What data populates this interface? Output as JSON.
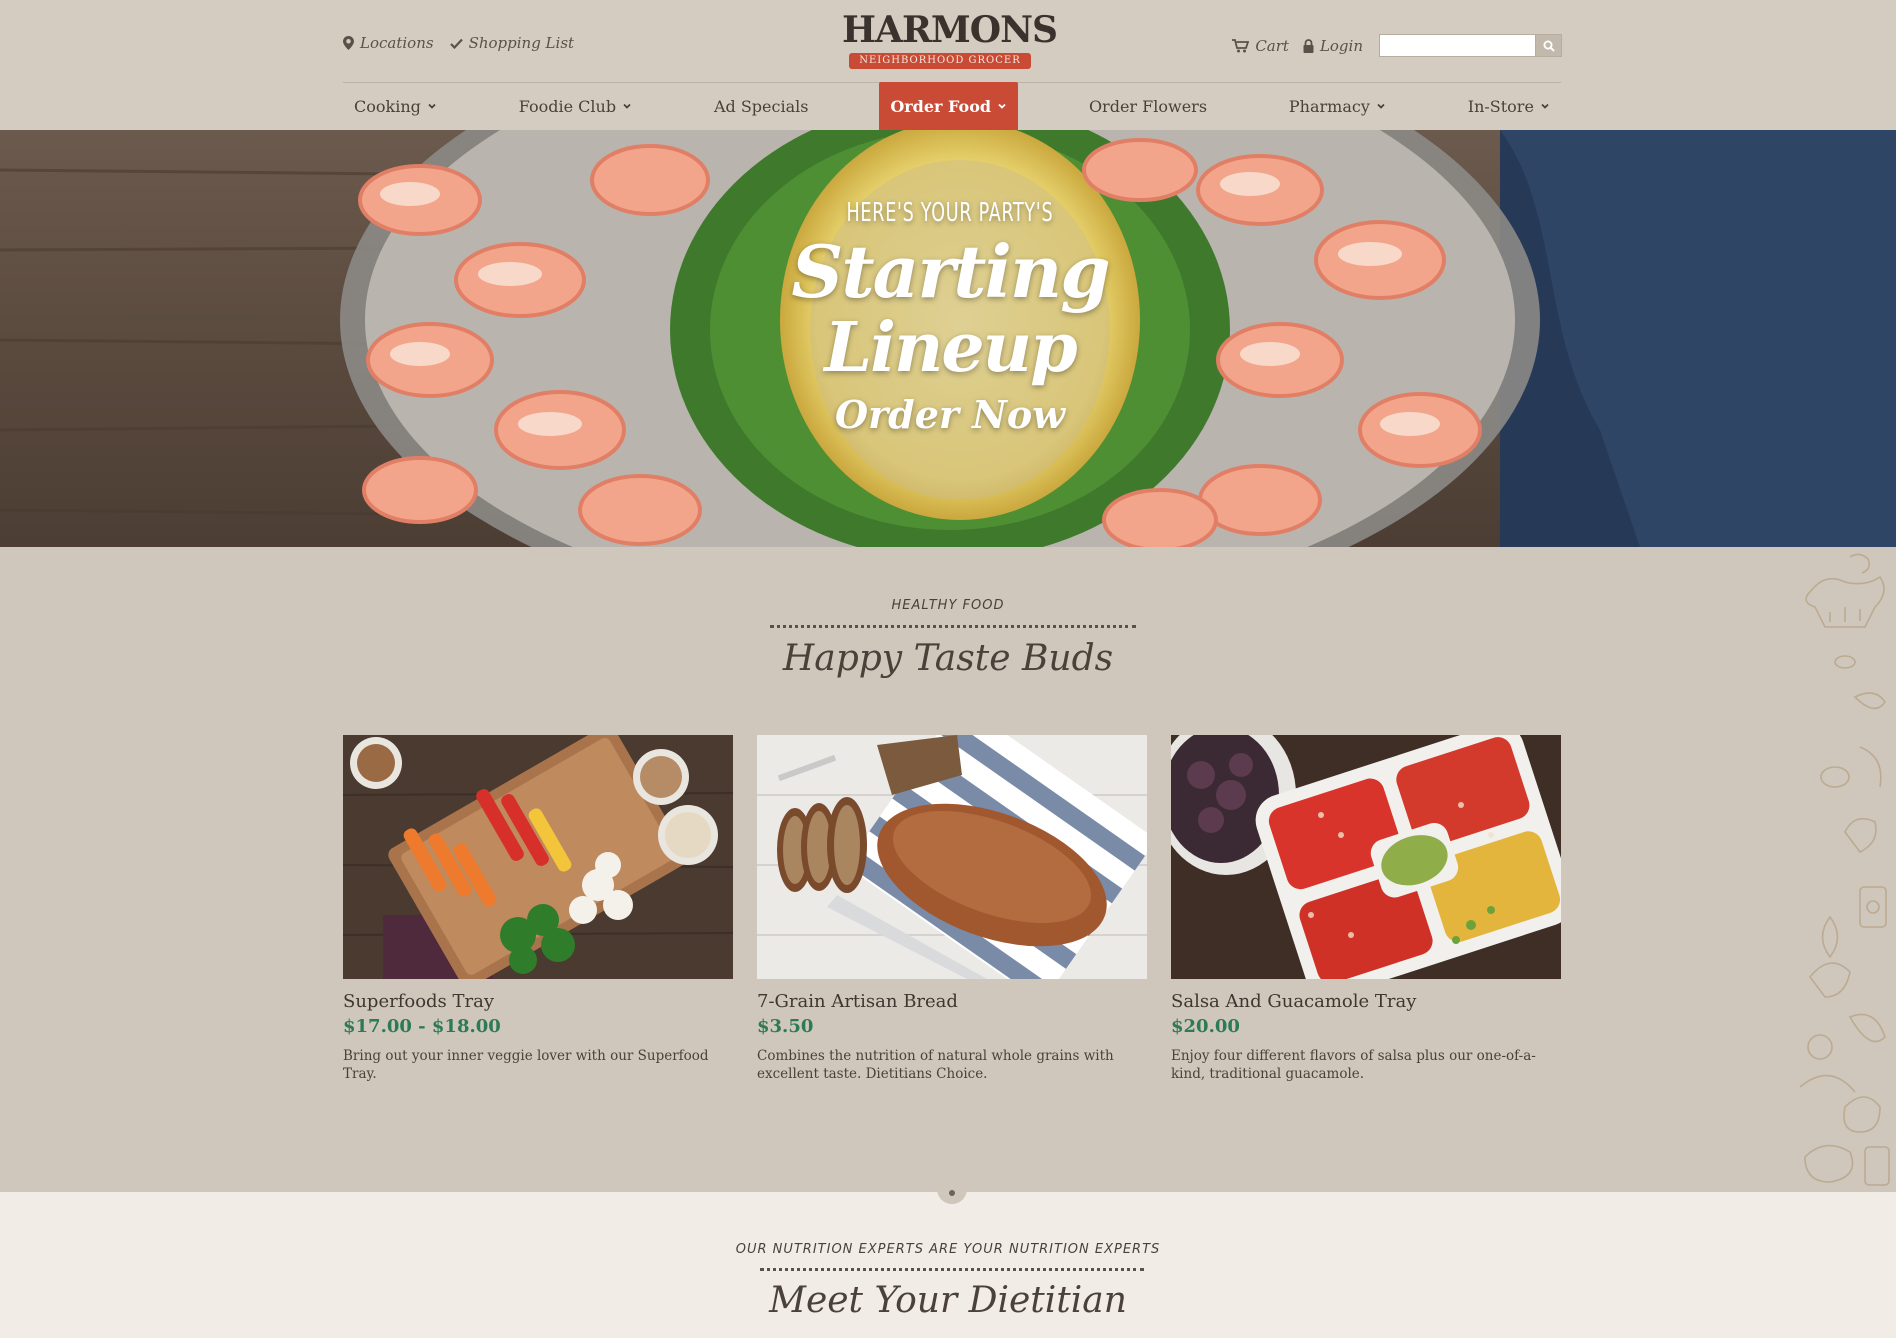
{
  "header": {
    "util_left": [
      {
        "label": "Locations",
        "icon": "map-pin-icon"
      },
      {
        "label": "Shopping List",
        "icon": "check-icon"
      }
    ],
    "logo": {
      "word": "HARMONS",
      "tagline": "NEIGHBORHOOD GROCER"
    },
    "util_right": [
      {
        "label": "Cart",
        "icon": "cart-icon"
      },
      {
        "label": "Login",
        "icon": "lock-icon"
      }
    ],
    "search": {
      "placeholder": "",
      "icon": "search-icon"
    }
  },
  "nav": {
    "items": [
      {
        "label": "Cooking",
        "has_dropdown": true,
        "active": false
      },
      {
        "label": "Foodie Club",
        "has_dropdown": true,
        "active": false
      },
      {
        "label": "Ad Specials",
        "has_dropdown": false,
        "active": false
      },
      {
        "label": "Order Food",
        "has_dropdown": true,
        "active": true
      },
      {
        "label": "Order Flowers",
        "has_dropdown": false,
        "active": false
      },
      {
        "label": "Pharmacy",
        "has_dropdown": true,
        "active": false
      },
      {
        "label": "In-Store",
        "has_dropdown": true,
        "active": false
      }
    ]
  },
  "hero": {
    "kicker": "HERE'S YOUR PARTY'S",
    "title_line1": "Starting",
    "title_line2": "Lineup",
    "cta": "Order Now"
  },
  "healthy": {
    "kicker": "HEALTHY FOOD",
    "title": "Happy Taste Buds",
    "cards": [
      {
        "title": "Superfoods Tray",
        "price": "$17.00 - $18.00",
        "description": "Bring out your inner veggie lover with our Superfood Tray."
      },
      {
        "title": "7-Grain Artisan Bread",
        "price": "$3.50",
        "description": "Combines the nutrition of natural whole grains with excellent taste. Dietitians Choice."
      },
      {
        "title": "Salsa And Guacamole Tray",
        "price": "$20.00",
        "description": "Enjoy four different flavors of salsa plus our one-of-a-kind, traditional guacamole."
      }
    ]
  },
  "dietitian": {
    "kicker": "OUR NUTRITION EXPERTS ARE YOUR NUTRITION EXPERTS",
    "title": "Meet Your Dietitian"
  },
  "colors": {
    "accent": "#c94b35",
    "price_green": "#2c7a57",
    "background": "#cfc7bb",
    "section_light": "#f1ece6"
  }
}
